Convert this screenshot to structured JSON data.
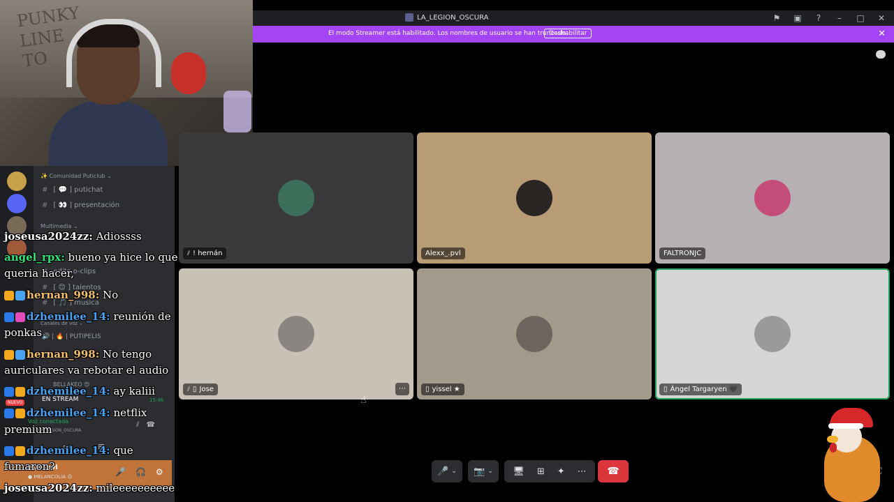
{
  "window": {
    "title": "LA_LEGION_OSCURA",
    "tools": [
      "flag-icon",
      "inbox-icon",
      "help-icon",
      "minimize-icon",
      "maximize-icon",
      "close-icon"
    ]
  },
  "banner": {
    "message": "El modo Streamer está habilitado. Los nombres de usuario se han truncado.",
    "disable_label": "Deshabilitar",
    "close_glyph": "✕"
  },
  "sidebar": {
    "server_name": "✨ Comunidad Puticlub ⌄",
    "channels": [
      {
        "label": "[ 💬 ] putichat"
      },
      {
        "label": "[ 👀 ] presentación"
      }
    ],
    "category_media": "Multimedia ⌄",
    "media_channels": [
      {
        "label": "edits-o-clips"
      },
      {
        "label": "[ 😊 ] talentos"
      },
      {
        "label": "[ 🎵 ] musica"
      }
    ],
    "category_voice": "Canales de voz ⌄",
    "voice_channel": "🔊 | 🔥 | PUTIPELIS",
    "bellakeo": "BELLAKEO 😍",
    "nuevo_badge": "NUEVO",
    "en_stream": "EN STREAM",
    "en_stream_time": "15:46",
    "voice_connected": "Voz conectada",
    "voice_path": "EM / LA_LEGION_OSCURA",
    "user_name": "MOL..pvl",
    "user_status": "● MELANCOLIA 😔"
  },
  "chat": [
    {
      "user": "joseusa2024zz:",
      "color": "#ffffff",
      "text": "Adiossss"
    },
    {
      "user": "angel_rpx:",
      "color": "#2fe37a",
      "text": "bueno ya hice lo que"
    },
    {
      "user": "",
      "color": "#ffffff",
      "text": "queria hacer,"
    },
    {
      "user": "hernan_998:",
      "color": "#f4c06a",
      "text": "No"
    },
    {
      "user": "dzhemilee_14:",
      "color": "#4aa3f0",
      "text": "reunión de"
    },
    {
      "user": "",
      "color": "#ffffff",
      "text": "ponkas"
    },
    {
      "user": "hernan_998:",
      "color": "#f4c06a",
      "text": "No tengo"
    },
    {
      "user": "",
      "color": "#ffffff",
      "text": "auriculares va rebotar el audio"
    },
    {
      "user": "dzhemilee_14:",
      "color": "#4aa3f0",
      "text": "ay kaliii"
    },
    {
      "user": "dzhemilee_14:",
      "color": "#4aa3f0",
      "text": "netflix"
    },
    {
      "user": "",
      "color": "#ffffff",
      "text": "premium"
    },
    {
      "user": "dzhemilee_14:",
      "color": "#4aa3f0",
      "text": "que"
    },
    {
      "user": "",
      "color": "#ffffff",
      "text": "fumaron?"
    },
    {
      "user": "joseusa2024zz:",
      "color": "#ffffff",
      "text": "mileeeeeeeeee"
    }
  ],
  "tiles": [
    {
      "name": "! hernán",
      "bg": "#3a3a3c",
      "avatar_color": "#3c6e5a",
      "muted": true,
      "speaking": false
    },
    {
      "name": "Alexx_.pvl",
      "bg": "#b89c76",
      "avatar_color": "#2a2623",
      "muted": false,
      "speaking": false
    },
    {
      "name": "FALTRONJC",
      "bg": "#b6b0b4",
      "avatar_color": "#c44d7a",
      "muted": false,
      "speaking": false
    },
    {
      "name": "Jose",
      "bg": "#c8c2b6",
      "avatar_color": "#8a8580",
      "muted": true,
      "speaking": false,
      "has_more": true
    },
    {
      "name": "yissel ★",
      "bg": "#a39a8c",
      "avatar_color": "#6e665e",
      "muted": false,
      "speaking": false
    },
    {
      "name": "Ángel Targaryen 🖤",
      "bg": "#d5d5d5",
      "avatar_color": "#9a9a9a",
      "muted": false,
      "speaking": true
    }
  ],
  "controls": {
    "mic_icon": "🎤",
    "chevron": "⌄",
    "camera_icon": "📷",
    "share_icon": "🖥",
    "activities_icon": "⊞",
    "soundboard_icon": "✦",
    "more_icon": "⋯",
    "leave_icon": "☎",
    "more_tile_icon": "⋯"
  }
}
